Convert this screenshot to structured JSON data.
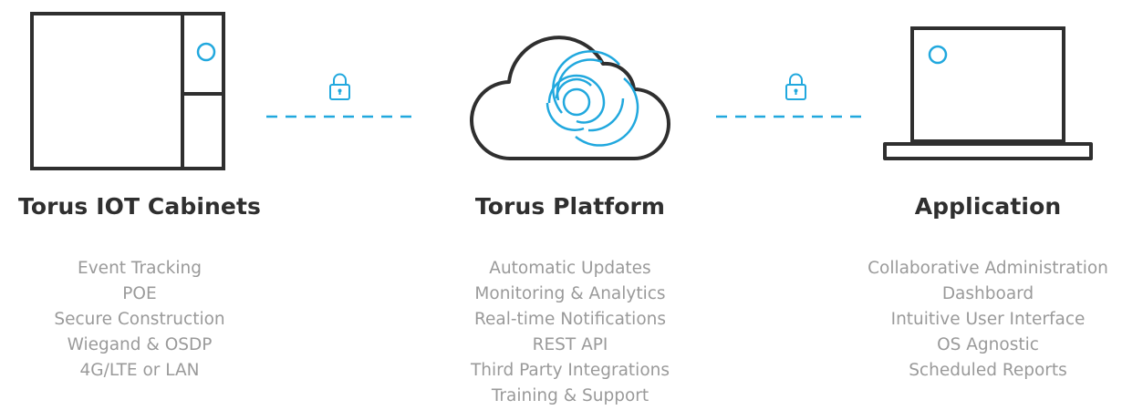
{
  "accent_color": "#21a8de",
  "line_color": "#2f2f2f",
  "components": [
    {
      "title": "Torus IOT Cabinets",
      "icon": "cabinet-icon",
      "features": [
        "Event Tracking",
        "POE",
        "Secure Construction",
        "Wiegand & OSDP",
        "4G/LTE or LAN"
      ]
    },
    {
      "title": "Torus Platform",
      "icon": "cloud-icon",
      "features": [
        "Automatic Updates",
        "Monitoring & Analytics",
        "Real-time Notifications",
        "REST API",
        "Third Party Integrations",
        "Training & Support"
      ]
    },
    {
      "title": "Application",
      "icon": "laptop-icon",
      "features": [
        "Collaborative Administration",
        "Dashboard",
        "Intuitive User Interface",
        "OS Agnostic",
        "Scheduled Reports"
      ]
    }
  ],
  "connectors": [
    {
      "icon": "lock-icon",
      "style": "dashed"
    },
    {
      "icon": "lock-icon",
      "style": "dashed"
    }
  ]
}
